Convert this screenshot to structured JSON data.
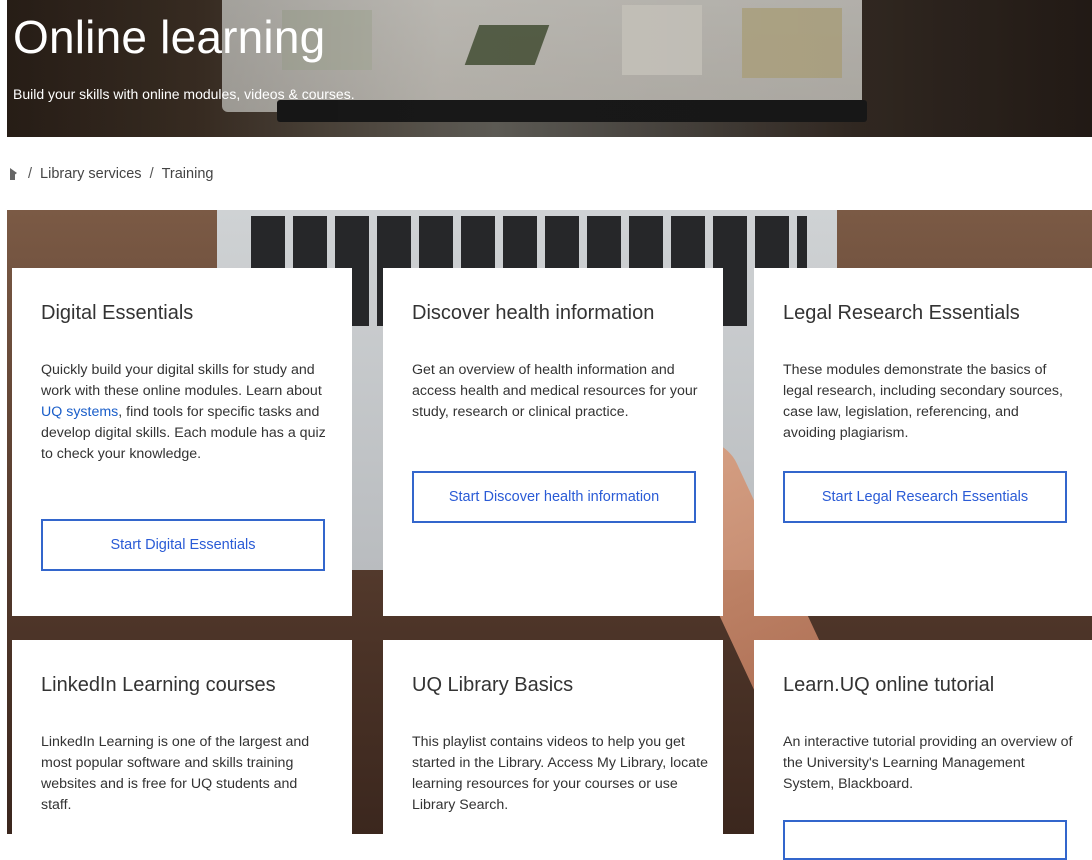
{
  "hero": {
    "title": "Online learning",
    "subtitle": "Build your skills with online modules, videos & courses."
  },
  "breadcrumb": {
    "items": [
      "Library services",
      "Training"
    ],
    "separator": "/"
  },
  "cards": [
    {
      "title": "Digital Essentials",
      "body_before_link": "Quickly build your digital skills for study and work with these online modules. Learn about ",
      "link": "UQ systems",
      "body_after_link": ", find tools for specific tasks and develop digital skills. Each module has a quiz to check your knowledge.",
      "cta": "Start Digital Essentials"
    },
    {
      "title": "Discover health information",
      "body": "Get an overview of health information and access health and medical resources for your study, research or clinical practice.",
      "cta": "Start Discover health information"
    },
    {
      "title": "Legal Research Essentials",
      "body": "These modules demonstrate the basics of legal research, including secondary sources, case law, legislation, referencing, and avoiding plagiarism.",
      "cta": "Start Legal Research Essentials"
    },
    {
      "title": "LinkedIn Learning courses",
      "body": "LinkedIn Learning is one of the largest and most popular software and skills training websites and is free for UQ students and staff."
    },
    {
      "title": "UQ Library Basics",
      "body": "This playlist contains videos to help you get started in the Library. Access My Library, locate learning resources for your courses or use Library Search."
    },
    {
      "title": "Learn.UQ online tutorial",
      "body": "An interactive tutorial providing an overview of the University's Learning Management System, Blackboard."
    }
  ],
  "colors": {
    "link": "#1a5ec9",
    "button_border": "#3366cc",
    "button_text": "#2a5bd6"
  }
}
